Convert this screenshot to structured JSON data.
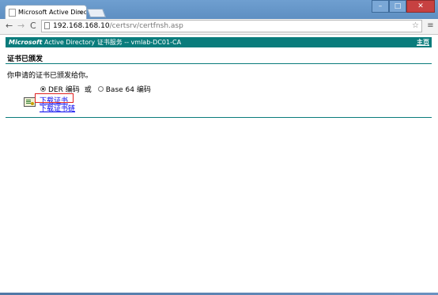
{
  "browser": {
    "tab_title": "Microsoft Active Directo",
    "tab_close": "×",
    "url_host": "192.168.168.10",
    "url_path": "/certsrv/certfnsh.asp",
    "star_icon": "☆",
    "menu_icon": "≡",
    "window_buttons": {
      "minimize": "–",
      "maximize": "□",
      "close": "✕"
    },
    "nav": {
      "back": "←",
      "forward": "→",
      "reload": "C"
    }
  },
  "banner": {
    "brand_bold": "Microsoft",
    "brand_rest": " Active Directory 证书服务  --  vmlab-DC01-CA",
    "home_link": "主页",
    "background_color": "#0a7c7c"
  },
  "page": {
    "heading": "证书已颁发",
    "message": "你申请的证书已颁发给你。",
    "encoding": {
      "der_label": "DER 编码",
      "or_label": "或",
      "base64_label": "Base 64 编码",
      "selected": "DER 编码"
    },
    "download_cert_link": "下载证书",
    "download_chain_link": "下载证书链",
    "highlight_color": "#e02020"
  }
}
